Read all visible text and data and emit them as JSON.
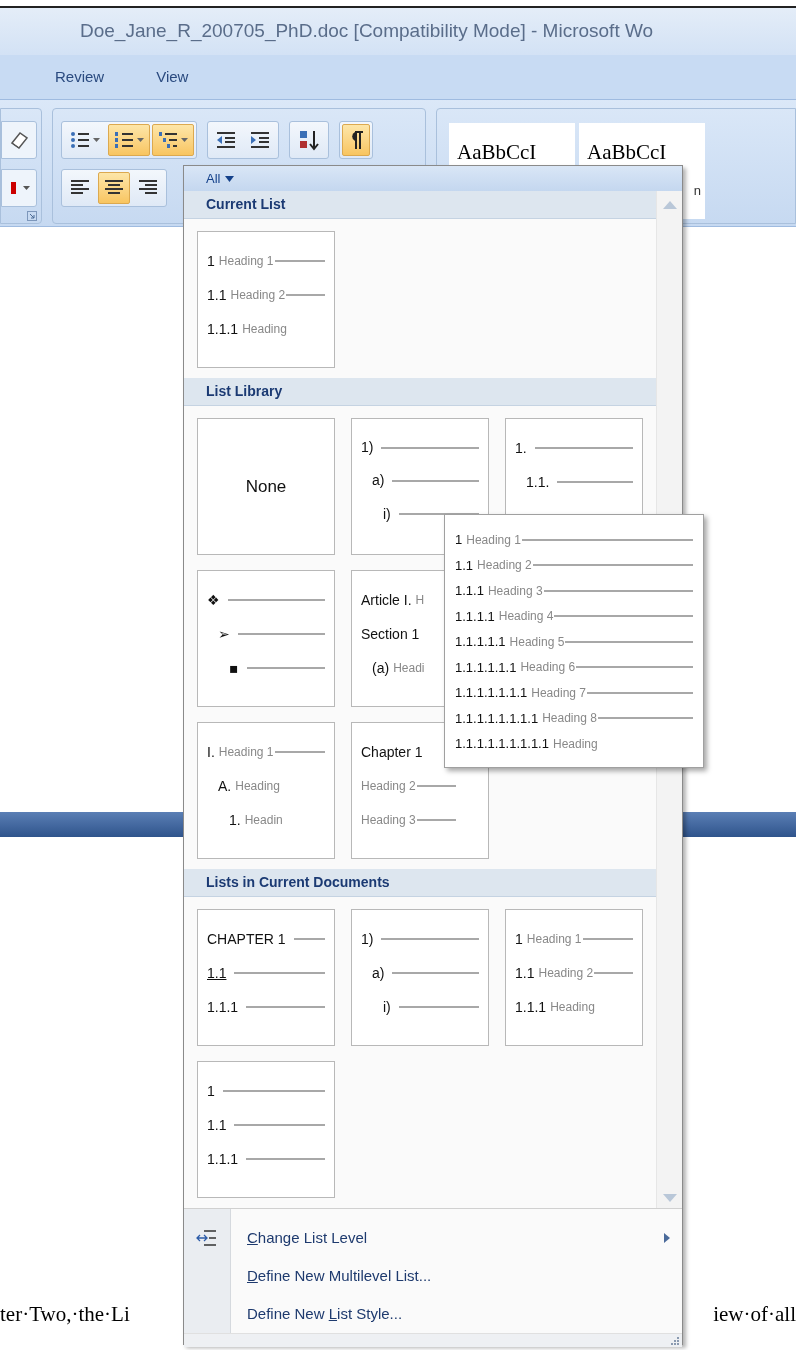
{
  "window": {
    "title": "Doe_Jane_R_200705_PhD.doc [Compatibility Mode] - Microsoft Wo"
  },
  "ribbon_tabs": [
    {
      "label": "Review"
    },
    {
      "label": "View"
    }
  ],
  "toolbar_rows": [
    {
      "groups": [
        {
          "buttons": [
            {
              "kind": "bullets",
              "dropdown": true,
              "selected": false
            },
            {
              "kind": "numbering",
              "dropdown": true,
              "selected": true
            },
            {
              "kind": "multilevel",
              "dropdown": true,
              "selected": true
            }
          ]
        },
        {
          "buttons": [
            {
              "kind": "decrease-indent",
              "dropdown": false,
              "selected": false
            },
            {
              "kind": "increase-indent",
              "dropdown": false,
              "selected": false
            }
          ]
        },
        {
          "buttons": [
            {
              "kind": "sort",
              "dropdown": false,
              "selected": false
            }
          ]
        },
        {
          "buttons": [
            {
              "kind": "pilcrow",
              "dropdown": false,
              "selected": true
            }
          ]
        }
      ]
    },
    {
      "groups": [
        {
          "buttons": [
            {
              "kind": "align-left",
              "dropdown": false,
              "selected": false
            },
            {
              "kind": "align-center",
              "dropdown": false,
              "selected": true
            },
            {
              "kind": "align-right",
              "dropdown": false,
              "selected": false
            }
          ]
        }
      ]
    }
  ],
  "styles": [
    {
      "sample": "AaBbCcI"
    },
    {
      "sample": "AaBbCcI",
      "name": "n"
    }
  ],
  "menu": {
    "filter": "All",
    "sections": [
      {
        "title": "Current List",
        "rows": [
          [
            {
              "kind": "list",
              "lines": [
                {
                  "number": "1",
                  "label": "Heading 1",
                  "rule": true
                },
                {
                  "number": "1.1",
                  "label": "Heading 2",
                  "rule": true
                },
                {
                  "number": "1.1.1",
                  "label": "Heading",
                  "rule": false
                }
              ]
            }
          ]
        ]
      },
      {
        "title": "List Library",
        "rows": [
          [
            {
              "kind": "none",
              "text": "None"
            },
            {
              "kind": "list",
              "lines": [
                {
                  "number": "1)",
                  "rule": true,
                  "children": [
                    {
                      "number": "a)",
                      "rule": true,
                      "children": [
                        {
                          "number": "i)",
                          "rule": true
                        }
                      ]
                    }
                  ]
                }
              ]
            },
            {
              "kind": "list",
              "lines": [
                {
                  "number": "1.",
                  "rule": true,
                  "children": [
                    {
                      "number": "1.1.",
                      "rule": true
                    }
                  ]
                }
              ]
            }
          ],
          [
            {
              "kind": "list",
              "lines": [
                {
                  "number": "❖",
                  "bullet": true,
                  "rule": true,
                  "children": [
                    {
                      "number": "➢",
                      "bullet": true,
                      "rule": true,
                      "children": [
                        {
                          "number": "▪",
                          "bullet": true,
                          "rule": true
                        }
                      ]
                    }
                  ]
                }
              ]
            },
            {
              "kind": "list",
              "lines": [
                {
                  "number": "Article I.",
                  "label": "H",
                  "rule": false
                },
                {
                  "number": "Section 1",
                  "rule": false,
                  "children": [
                    {
                      "number": "(a)",
                      "label": "Headi",
                      "rule": false
                    }
                  ]
                }
              ]
            }
          ],
          [
            {
              "kind": "list",
              "lines": [
                {
                  "number": "I.",
                  "label": "Heading 1",
                  "rule": true,
                  "children": [
                    {
                      "number": "A.",
                      "label": "Heading",
                      "rule": false,
                      "children": [
                        {
                          "number": "1.",
                          "label": "Headin",
                          "rule": false
                        }
                      ]
                    }
                  ]
                }
              ]
            },
            {
              "kind": "list",
              "lines": [
                {
                  "number": "Chapter 1",
                  "rule": false
                },
                {
                  "label": "Heading 2",
                  "rule": true
                },
                {
                  "label": "Heading 3",
                  "rule": true
                }
              ]
            }
          ]
        ]
      },
      {
        "title": "Lists in Current Documents",
        "rows": [
          [
            {
              "kind": "list",
              "lines": [
                {
                  "number": "CHAPTER 1",
                  "rule": true
                },
                {
                  "number": "1.1",
                  "underlined": true,
                  "rule": true
                },
                {
                  "number": "1.1.1",
                  "rule": true
                }
              ]
            },
            {
              "kind": "list",
              "lines": [
                {
                  "number": "1)",
                  "rule": true,
                  "children": [
                    {
                      "number": "a)",
                      "rule": true,
                      "children": [
                        {
                          "number": "i)",
                          "rule": true
                        }
                      ]
                    }
                  ]
                }
              ]
            },
            {
              "kind": "list",
              "lines": [
                {
                  "number": "1",
                  "label": "Heading 1",
                  "rule": true
                },
                {
                  "number": "1.1",
                  "label": "Heading 2",
                  "rule": true
                },
                {
                  "number": "1.1.1",
                  "label": "Heading",
                  "rule": false
                }
              ]
            }
          ],
          [
            {
              "kind": "list",
              "lines": [
                {
                  "number": "1",
                  "rule": true
                },
                {
                  "number": "1.1",
                  "rule": true
                },
                {
                  "number": "1.1.1",
                  "rule": true
                }
              ]
            }
          ]
        ]
      }
    ],
    "preview": [
      {
        "number": "1",
        "label": "Heading 1",
        "rule": true
      },
      {
        "number": "1.1",
        "label": "Heading 2",
        "rule": true
      },
      {
        "number": "1.1.1",
        "label": "Heading 3",
        "rule": true
      },
      {
        "number": "1.1.1.1",
        "label": "Heading 4",
        "rule": true
      },
      {
        "number": "1.1.1.1.1",
        "label": "Heading 5",
        "rule": true
      },
      {
        "number": "1.1.1.1.1.1",
        "label": "Heading 6",
        "rule": true
      },
      {
        "number": "1.1.1.1.1.1.1",
        "label": "Heading 7",
        "rule": true
      },
      {
        "number": "1.1.1.1.1.1.1.1",
        "label": "Heading 8",
        "rule": true
      },
      {
        "number": "1.1.1.1.1.1.1.1.1",
        "label": "Heading",
        "rule": false
      }
    ],
    "commands": [
      {
        "label_parts": {
          "key": "C",
          "after": "hange List Level"
        },
        "submenu": true,
        "icon": true
      },
      {
        "label_parts": {
          "key": "D",
          "after": "efine New Multilevel List..."
        },
        "submenu": false,
        "icon": false
      },
      {
        "label_parts": {
          "before": "Define New ",
          "key": "L",
          "after": "ist Style..."
        },
        "submenu": false,
        "icon": false
      }
    ]
  },
  "document": {
    "line_parts": [
      "ter·Two,·the·Li",
      "iew·of·all"
    ]
  }
}
